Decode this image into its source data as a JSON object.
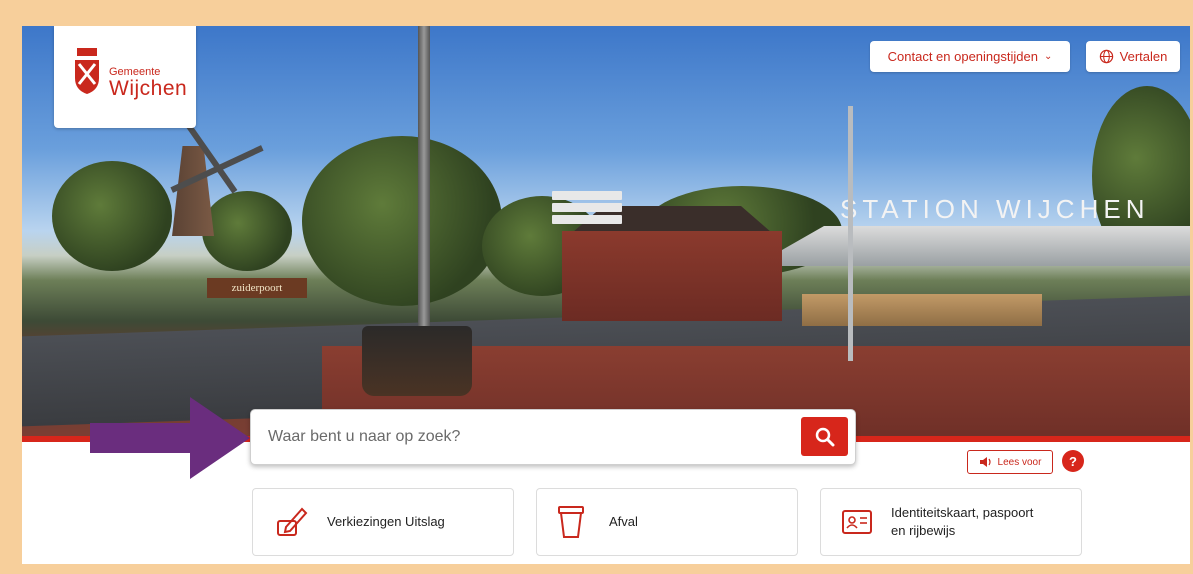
{
  "logo": {
    "line1": "Gemeente",
    "line2": "Wijchen"
  },
  "header": {
    "contact_label": "Contact en openingstijden",
    "translate_label": "Vertalen"
  },
  "hero": {
    "station_sign": "STATION WIJCHEN",
    "roundabout_sign": "zuiderpoort"
  },
  "search": {
    "placeholder": "Waar bent u naar op zoek?"
  },
  "accessibility": {
    "read_aloud_label": "Lees voor",
    "help_label": "?"
  },
  "tiles": [
    {
      "label": "Verkiezingen Uitslag",
      "icon": "ballot-pen-icon"
    },
    {
      "label": "Afval",
      "icon": "waste-bin-icon"
    },
    {
      "label_line1": "Identiteitskaart, paspoort",
      "label_line2": "en rijbewijs",
      "icon": "id-card-icon"
    }
  ],
  "colors": {
    "brand_red": "#d7261b",
    "frame": "#f7cf9b",
    "annotation_arrow": "#6a2d7e"
  }
}
